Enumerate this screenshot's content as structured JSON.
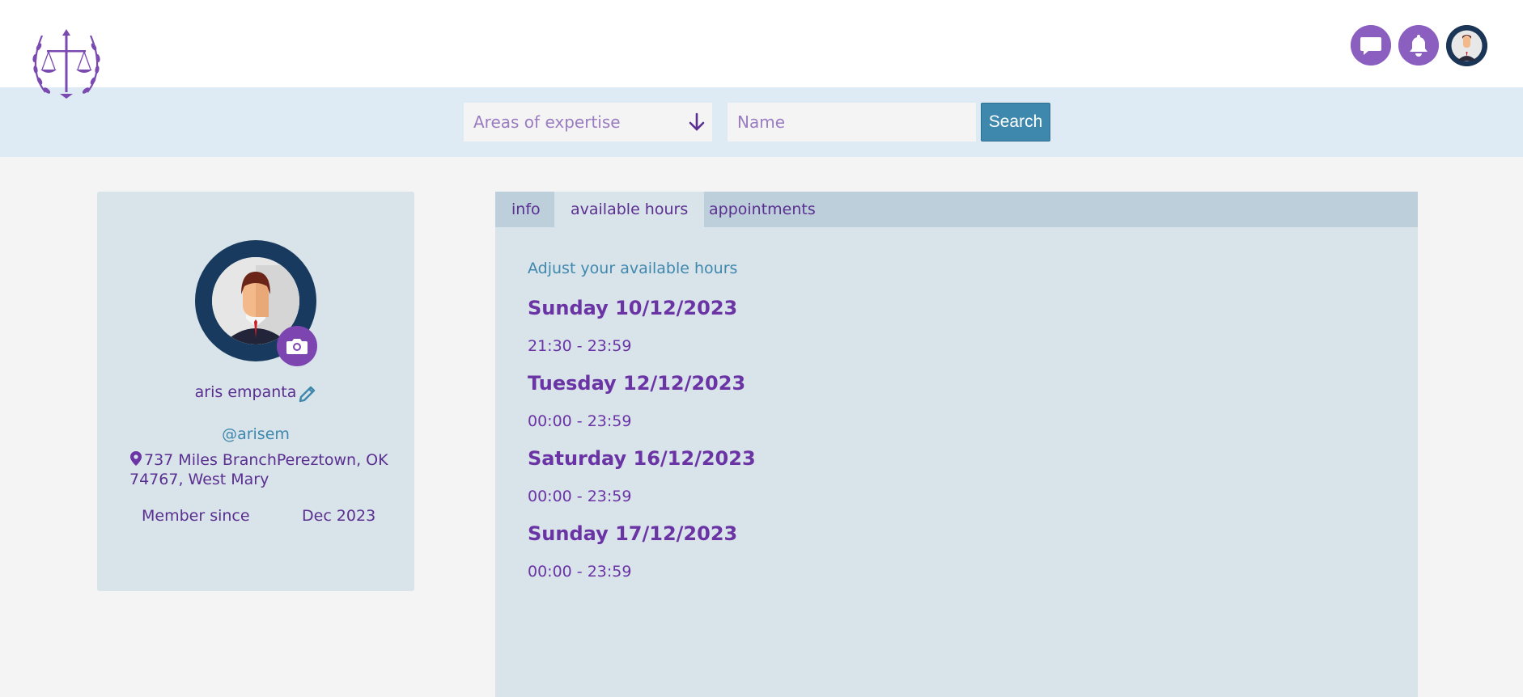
{
  "header": {
    "icons": {
      "logo": "scales-of-justice-laurel-logo",
      "messages": "chat-bubble-icon",
      "notifications": "bell-icon",
      "avatar": "user-avatar"
    }
  },
  "search": {
    "expertise_placeholder": "Areas of expertise",
    "name_placeholder": "Name",
    "button_label": "Search"
  },
  "profile": {
    "name": "aris empanta",
    "handle": "@arisem",
    "address": "737 Miles BranchPereztown, OK 74767, West Mary",
    "member_since_label": "Member since",
    "member_since_value": "Dec 2023"
  },
  "tabs": [
    {
      "label": "info"
    },
    {
      "label": "available hours"
    },
    {
      "label": "appointments"
    }
  ],
  "available_hours": {
    "title": "Adjust your available hours",
    "days": [
      {
        "day": "Sunday 10/12/2023",
        "hours": "21:30 - 23:59"
      },
      {
        "day": "Tuesday 12/12/2023",
        "hours": "00:00 - 23:59"
      },
      {
        "day": "Saturday 16/12/2023",
        "hours": "00:00 - 23:59"
      },
      {
        "day": "Sunday 17/12/2023",
        "hours": "00:00 - 23:59"
      }
    ]
  },
  "colors": {
    "accent_purple": "#8b5fbf",
    "text_purple": "#5a2f90",
    "link_blue": "#3f88ad",
    "panel_bg": "#d9e3ea"
  }
}
